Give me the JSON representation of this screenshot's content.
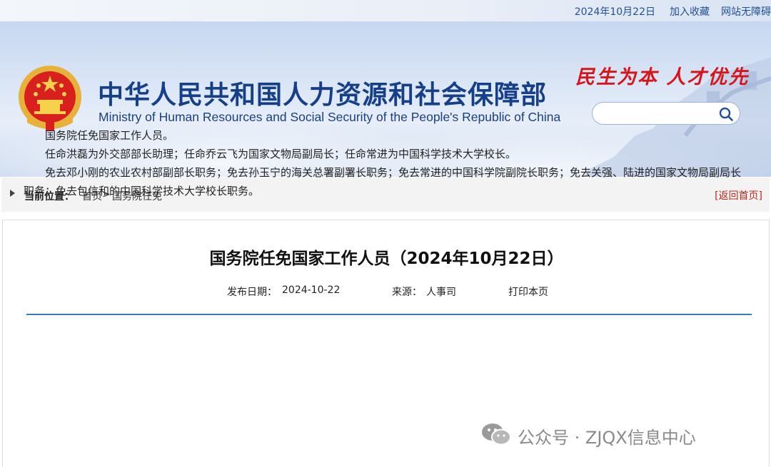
{
  "topbar": {
    "date": "2024年10月22日",
    "add_favorite": "加入收藏",
    "accessibility": "网站无障碍"
  },
  "header": {
    "ministry_cn": "中华人民共和国人力资源和社会保障部",
    "ministry_en": "Ministry of Human Resources and Social Security of the People's Republic of China",
    "slogan": "民生为本 人才优先",
    "search_placeholder": "",
    "emblem_icon": "national-emblem-icon",
    "search_icon": "search-icon"
  },
  "breadcrumb": {
    "label": "当前位置：",
    "home": "首页",
    "separator": ">",
    "current": "国务院任免",
    "back_home": "[返回首页]"
  },
  "article": {
    "title": "国务院任免国家工作人员（2024年10月22日）",
    "publish_label": "发布日期：",
    "publish_date": "2024-10-22",
    "source_label": "来源：",
    "source": "人事司",
    "print": "打印本页",
    "paragraphs": [
      "国务院任免国家工作人员。",
      "任命洪磊为外交部部长助理；任命乔云飞为国家文物局副局长；任命常进为中国科学技术大学校长。",
      "免去邓小刚的农业农村部副部长职务；免去孙玉宁的海关总署副署长职务；免去常进的中国科学院副院长职务；免去关强、陆进的国家文物局副局长职务；免去包信和的中国科学技术大学校长职务。"
    ]
  },
  "watermark": {
    "text": "公众号 · ZJQX信息中心",
    "icon": "wechat-icon"
  },
  "colors": {
    "brand_blue": "#163f8a",
    "slogan_red": "#d8141b",
    "rule_blue": "#3b79c4",
    "link_red": "#c0271b"
  }
}
